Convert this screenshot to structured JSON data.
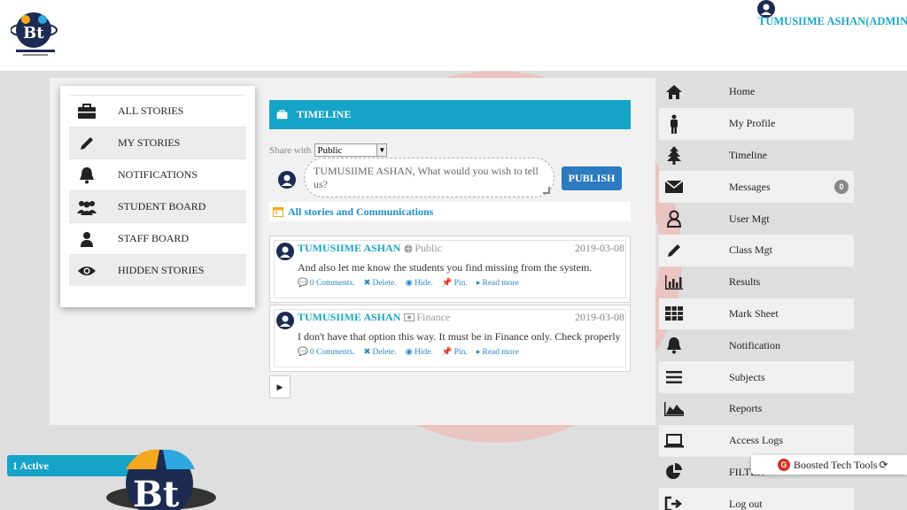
{
  "header": {
    "user_name": "TUMUSIIME ASHAN(ADMIN)"
  },
  "left_menu": {
    "items": [
      {
        "label": "ALL STORIES",
        "icon": "briefcase-icon"
      },
      {
        "label": "MY STORIES",
        "icon": "pencil-icon"
      },
      {
        "label": "NOTIFICATIONS",
        "icon": "bell-icon"
      },
      {
        "label": "STUDENT BOARD",
        "icon": "users-icon"
      },
      {
        "label": "STAFF BOARD",
        "icon": "user-icon"
      },
      {
        "label": "HIDDEN STORIES",
        "icon": "eye-icon"
      }
    ]
  },
  "timeline": {
    "title": "TIMELINE",
    "share_label": "Share with",
    "share_value": "Public",
    "compose_placeholder": "TUMUSIIME ASHAN, What would you wish to tell us?",
    "publish_label": "PUBLISH",
    "all_stories_label": "All stories and Communications",
    "posts": [
      {
        "author": "TUMUSIIME ASHAN",
        "visibility": "Public",
        "date": "2019-03-08",
        "text": "And also let me know the students you find missing from the system.",
        "comments": "0 Comments.",
        "delete": "Delete.",
        "hide": "Hide.",
        "pin": "Pin.",
        "read_more": "Read more"
      },
      {
        "author": "TUMUSIIME ASHAN",
        "visibility": "Finance",
        "date": "2019-03-08",
        "text": "I don't have that option this way. It must be in Finance only. Check properly",
        "comments": "0 Comments.",
        "delete": "Delete.",
        "hide": "Hide.",
        "pin": "Pin.",
        "read_more": "Read more"
      }
    ]
  },
  "right_menu": {
    "items": [
      {
        "label": "Home",
        "icon": "home-icon"
      },
      {
        "label": "My Profile",
        "icon": "person-icon"
      },
      {
        "label": "Timeline",
        "icon": "tree-icon"
      },
      {
        "label": "Messages",
        "icon": "envelope-icon",
        "badge": "0"
      },
      {
        "label": "User Mgt",
        "icon": "user-outline-icon"
      },
      {
        "label": "Class Mgt",
        "icon": "pencil-icon"
      },
      {
        "label": "Results",
        "icon": "bar-chart-icon"
      },
      {
        "label": "Mark Sheet",
        "icon": "table-icon"
      },
      {
        "label": "Notification",
        "icon": "bell-icon"
      },
      {
        "label": "Subjects",
        "icon": "list-icon"
      },
      {
        "label": "Reports",
        "icon": "area-chart-icon"
      },
      {
        "label": "Access Logs",
        "icon": "laptop-icon"
      },
      {
        "label": "FILTER",
        "icon": "pie-chart-icon"
      },
      {
        "label": "Log out",
        "icon": "sign-out-icon"
      }
    ]
  },
  "footer": {
    "active_label": "1 Active",
    "tools_label": "Boosted Tech Tools"
  },
  "colors": {
    "accent": "#16a3c8",
    "publish": "#2a7bbf",
    "link": "#2a87c8"
  }
}
